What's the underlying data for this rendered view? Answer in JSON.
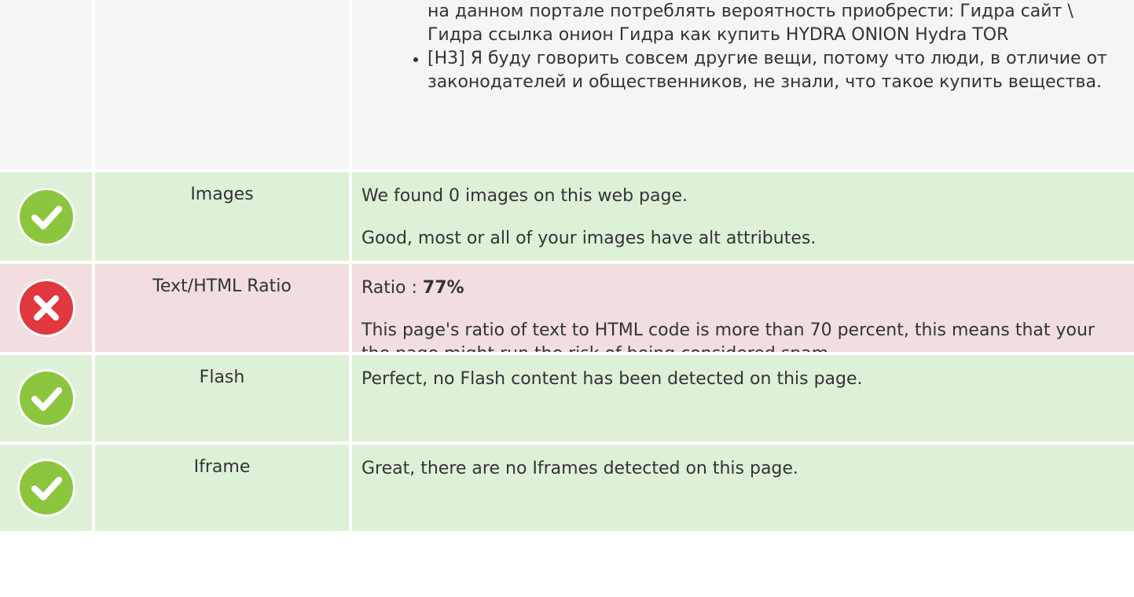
{
  "headings_list": {
    "items": [
      {
        "text": "на данном портале потреблять вероятность приобрести: Гидра сайт \\ Гидра ссылка онион Гидра как купить HYDRA ONION Hydra TOR",
        "bullet": false
      },
      {
        "text": "[H3] Я буду говорить совсем другие вещи, потому что люди, в отличие от законодателей и общественников, не знали, что такое купить вещества.",
        "bullet": true
      }
    ]
  },
  "rows": {
    "images": {
      "status": "pass",
      "icon": "check-icon",
      "label": "Images",
      "line1": "We found 0 images on this web page.",
      "line2": "Good, most or all of your images have alt attributes."
    },
    "text_html_ratio": {
      "status": "fail",
      "icon": "cross-icon",
      "label": "Text/HTML Ratio",
      "ratio_label": "Ratio : ",
      "ratio_value": "77%",
      "line2": "This page's ratio of text to HTML code is more than 70 percent, this means that your the page might run the risk of being considered spam."
    },
    "flash": {
      "status": "pass",
      "icon": "check-icon",
      "label": "Flash",
      "line1": "Perfect, no Flash content has been detected on this page."
    },
    "iframe": {
      "status": "pass",
      "icon": "check-icon",
      "label": "Iframe",
      "line1": "Great, there are no Iframes detected on this page."
    }
  },
  "colors": {
    "pass_bg": "#dff0d8",
    "fail_bg": "#f2dede",
    "neutral_bg": "#f5f5f5",
    "check_green": "#8cc63f",
    "cross_red": "#e0383e"
  }
}
